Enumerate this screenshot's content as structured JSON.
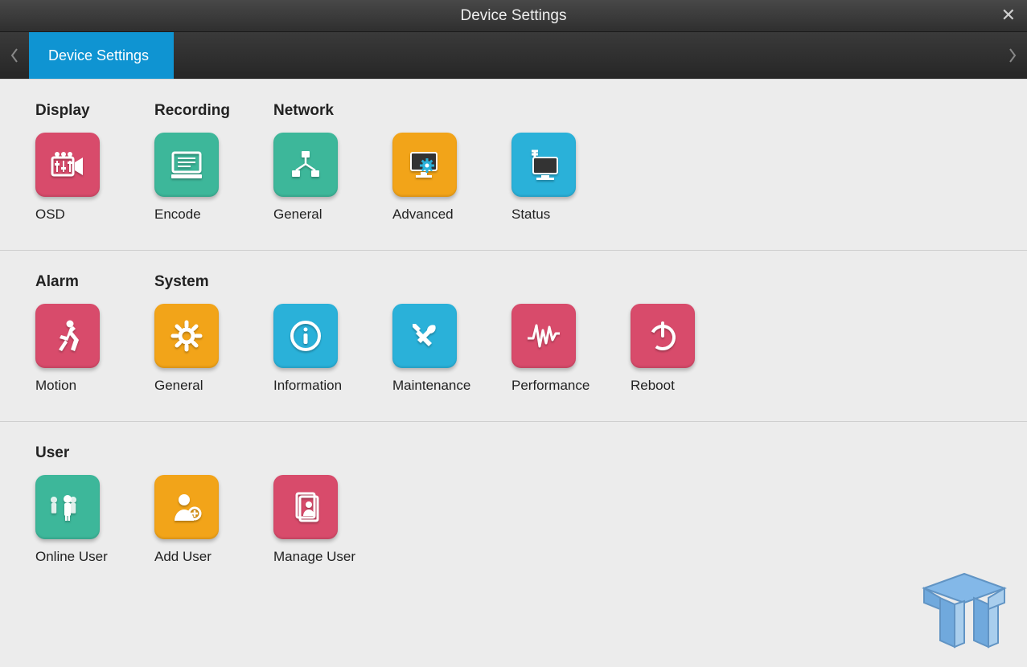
{
  "window": {
    "title": "Device Settings"
  },
  "tab": {
    "label": "Device Settings"
  },
  "sections": [
    {
      "headers": [
        "Display",
        "Recording",
        "Network"
      ],
      "items": [
        {
          "label": "OSD",
          "icon": "camera-sliders-icon",
          "color": "pink"
        },
        {
          "label": "Encode",
          "icon": "monitor-list-icon",
          "color": "teal"
        },
        {
          "label": "General",
          "icon": "network-nodes-icon",
          "color": "teal"
        },
        {
          "label": "Advanced",
          "icon": "computer-gear-icon",
          "color": "orange"
        },
        {
          "label": "Status",
          "icon": "monitor-antenna-icon",
          "color": "blue"
        }
      ]
    },
    {
      "headers": [
        "Alarm",
        "System"
      ],
      "items": [
        {
          "label": "Motion",
          "icon": "running-person-icon",
          "color": "pink"
        },
        {
          "label": "General",
          "icon": "gear-icon",
          "color": "orange"
        },
        {
          "label": "Information",
          "icon": "info-icon",
          "color": "blue"
        },
        {
          "label": "Maintenance",
          "icon": "tools-icon",
          "color": "blue"
        },
        {
          "label": "Performance",
          "icon": "waveform-icon",
          "color": "pink"
        },
        {
          "label": "Reboot",
          "icon": "power-icon",
          "color": "pink"
        }
      ]
    },
    {
      "headers": [
        "User"
      ],
      "items": [
        {
          "label": "Online User",
          "icon": "users-group-icon",
          "color": "teal"
        },
        {
          "label": "Add User",
          "icon": "user-plus-icon",
          "color": "orange"
        },
        {
          "label": "Manage User",
          "icon": "user-docs-icon",
          "color": "pink"
        }
      ]
    }
  ]
}
